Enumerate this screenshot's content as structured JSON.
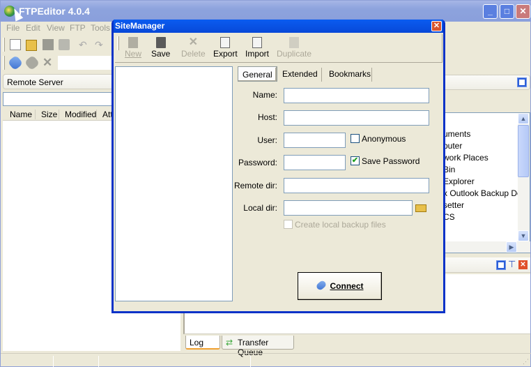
{
  "app": {
    "title": "FTPEditor 4.0.4",
    "caption_buttons": {
      "minimize": "_",
      "maximize": "□",
      "close": "✕"
    }
  },
  "menu": [
    "File",
    "Edit",
    "View",
    "FTP",
    "Tools"
  ],
  "left_panel": {
    "header": "Remote Server",
    "path_value": "",
    "columns": [
      "Name",
      "Size",
      "Modified",
      "Att"
    ]
  },
  "right_tree": {
    "items": [
      "uments",
      "puter",
      "work Places",
      " Bin",
      "Explorer",
      "x Outlook Backup De",
      "setter",
      "CS"
    ]
  },
  "bottom_tabs": [
    "Log",
    "Transfer Queue"
  ],
  "dialog": {
    "title": "SiteManager",
    "toolbar": [
      {
        "label": "New",
        "icon": "new-icon",
        "enabled": false
      },
      {
        "label": "Save",
        "icon": "save-icon",
        "enabled": true
      },
      {
        "label": "Delete",
        "icon": "delete-icon",
        "enabled": false
      },
      {
        "label": "Export",
        "icon": "export-icon",
        "enabled": true
      },
      {
        "label": "Import",
        "icon": "import-icon",
        "enabled": true
      },
      {
        "label": "Duplicate",
        "icon": "duplicate-icon",
        "enabled": false
      }
    ],
    "tabs": [
      "General",
      "Extended",
      "Bookmarks"
    ],
    "active_tab": "General",
    "fields": {
      "name": {
        "label": "Name:",
        "value": ""
      },
      "host": {
        "label": "Host:",
        "value": ""
      },
      "user": {
        "label": "User:",
        "value": ""
      },
      "password": {
        "label": "Password:",
        "value": ""
      },
      "remote_dir": {
        "label": "Remote dir:",
        "value": ""
      },
      "local_dir": {
        "label": "Local dir:",
        "value": ""
      }
    },
    "anonymous": {
      "label": "Anonymous",
      "checked": false
    },
    "save_password": {
      "label": "Save Password",
      "checked": true
    },
    "create_backup": {
      "label": "Create local backup files",
      "checked": false,
      "enabled": false
    },
    "connect_label": "Connect"
  }
}
